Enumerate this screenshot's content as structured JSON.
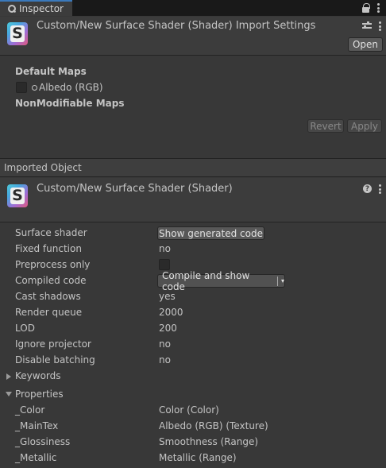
{
  "tab": {
    "label": "Inspector"
  },
  "import_header": {
    "title": "Custom/New Surface Shader (Shader) Import Settings",
    "open_label": "Open"
  },
  "import_settings": {
    "default_maps_label": "Default Maps",
    "albedo_label": "Albedo (RGB)",
    "nonmodifiable_label": "NonModifiable Maps",
    "revert_label": "Revert",
    "apply_label": "Apply"
  },
  "imported_object": {
    "bar_label": "Imported Object",
    "title": "Custom/New Surface Shader (Shader)"
  },
  "shader_icon_letter": "S",
  "help_glyph": "?",
  "props": {
    "surface_shader": {
      "label": "Surface shader",
      "button": "Show generated code"
    },
    "fixed_function": {
      "label": "Fixed function",
      "value": "no"
    },
    "preprocess_only": {
      "label": "Preprocess only",
      "checked": false
    },
    "compiled_code": {
      "label": "Compiled code",
      "button": "Compile and show code",
      "caret": "▾"
    },
    "cast_shadows": {
      "label": "Cast shadows",
      "value": "yes"
    },
    "render_queue": {
      "label": "Render queue",
      "value": "2000"
    },
    "lod": {
      "label": "LOD",
      "value": "200"
    },
    "ignore_projector": {
      "label": "Ignore projector",
      "value": "no"
    },
    "disable_batching": {
      "label": "Disable batching",
      "value": "no"
    }
  },
  "keywords_label": "Keywords",
  "properties_label": "Properties",
  "properties": [
    {
      "name": "_Color",
      "value": "Color (Color)"
    },
    {
      "name": "_MainTex",
      "value": "Albedo (RGB) (Texture)"
    },
    {
      "name": "_Glossiness",
      "value": "Smoothness (Range)"
    },
    {
      "name": "_Metallic",
      "value": "Metallic (Range)"
    }
  ],
  "colors": {
    "background": "#383838",
    "tab_accent": "#3a79bb",
    "text": "#c4c4c4"
  },
  "icons": {
    "tab": "inspector-icon",
    "lock": "lock-icon",
    "menu": "kebab-menu-icon",
    "preset": "sliders-icon",
    "help": "help-icon"
  }
}
